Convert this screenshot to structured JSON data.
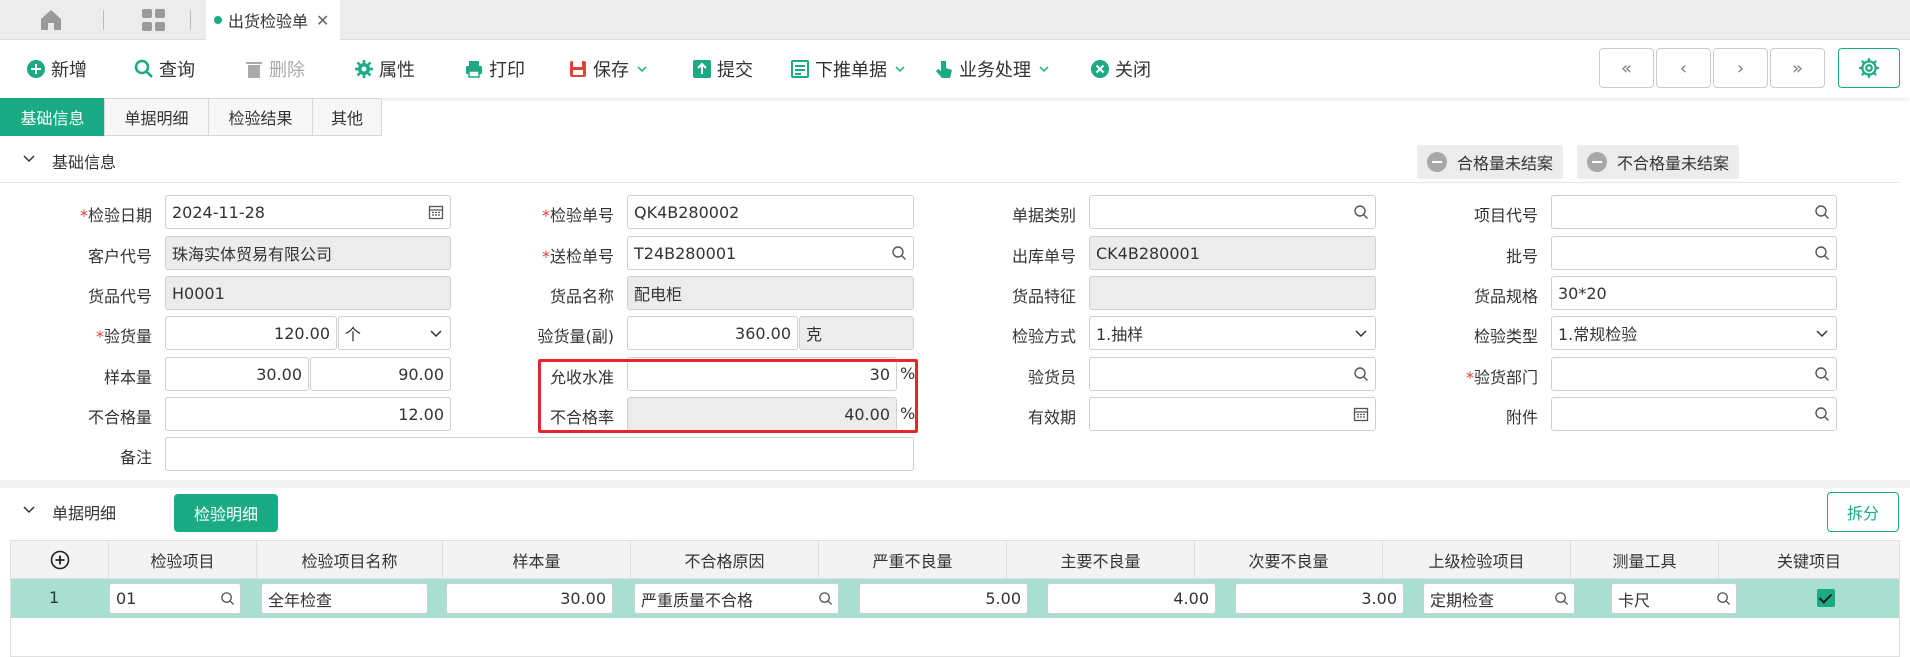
{
  "tabs": {
    "doc_tab_label": "出货检验单"
  },
  "toolbar": {
    "new": "新增",
    "query": "查询",
    "delete": "删除",
    "properties": "属性",
    "print": "打印",
    "save": "保存",
    "submit": "提交",
    "push_down": "下推单据",
    "business": "业务处理",
    "close": "关闭"
  },
  "subtabs": [
    "基础信息",
    "单据明细",
    "检验结果",
    "其他"
  ],
  "basic": {
    "section_title": "基础信息",
    "pill_qualified": "合格量未结案",
    "pill_unqualified": "不合格量未结案"
  },
  "form": {
    "inspect_date_label": "检验日期",
    "inspect_date": "2024-11-28",
    "inspect_no_label": "检验单号",
    "inspect_no": "QK4B280002",
    "doc_type_label": "单据类别",
    "doc_type": "",
    "project_code_label": "项目代号",
    "project_code": "",
    "customer_label": "客户代号",
    "customer": "珠海实体贸易有限公司",
    "send_no_label": "送检单号",
    "send_no": "T24B280001",
    "outbound_label": "出库单号",
    "outbound": "CK4B280001",
    "batch_label": "批号",
    "batch": "",
    "goods_code_label": "货品代号",
    "goods_code": "H0001",
    "goods_name_label": "货品名称",
    "goods_name": "配电柜",
    "goods_feature_label": "货品特征",
    "goods_feature": "",
    "goods_spec_label": "货品规格",
    "goods_spec": "30*20",
    "inspect_qty_label": "验货量",
    "inspect_qty": "120.00",
    "inspect_unit": "个",
    "inspect_qty_sub_label": "验货量(副)",
    "inspect_qty_sub": "360.00",
    "inspect_unit_sub": "克",
    "method_label": "检验方式",
    "method": "1.抽样",
    "inspect_type_label": "检验类型",
    "inspect_type": "1.常规检验",
    "sample_label": "样本量",
    "sample1": "30.00",
    "sample2": "90.00",
    "accept_label": "允收水准",
    "accept": "30",
    "percent": "%",
    "inspector_label": "验货员",
    "inspector": "",
    "dept_label": "验货部门",
    "dept": "",
    "unqualified_label": "不合格量",
    "unqualified": "12.00",
    "unqualified_rate_label": "不合格率",
    "unqualified_rate": "40.00",
    "validity_label": "有效期",
    "validity": "",
    "attachment_label": "附件",
    "attachment": "",
    "remark_label": "备注",
    "remark": ""
  },
  "detail": {
    "section_title": "单据明细",
    "tab_label": "检验明细",
    "split_label": "拆分",
    "columns": [
      "检验项目",
      "检验项目名称",
      "样本量",
      "不合格原因",
      "严重不良量",
      "主要不良量",
      "次要不良量",
      "上级检验项目",
      "测量工具",
      "关键项目"
    ],
    "rows": [
      {
        "no": "1",
        "item": "01",
        "item_name": "全年检查",
        "sample": "30.00",
        "reason": "严重质量不合格",
        "severe": "5.00",
        "major": "4.00",
        "minor": "3.00",
        "parent": "定期检查",
        "tool": "卡尺"
      }
    ]
  },
  "colors": {
    "accent": "#1aab84",
    "highlight_box": "#e0282e",
    "selected_row": "#a9dfd1"
  }
}
